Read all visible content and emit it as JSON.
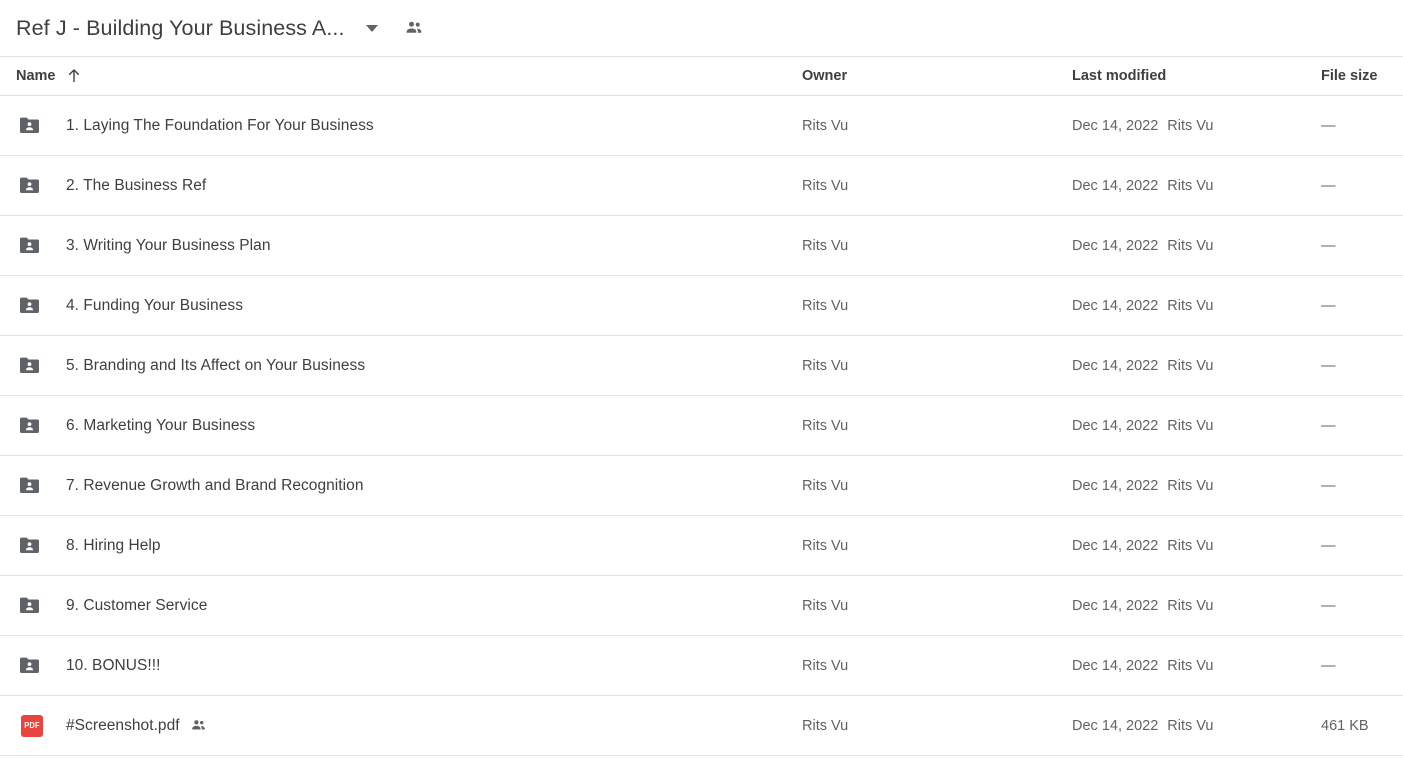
{
  "header": {
    "folder_title": "Ref J - Building Your Business A...",
    "caret_icon": "chevron-down-icon",
    "shared_icon": "people-shared-icon"
  },
  "table": {
    "columns": {
      "name": "Name",
      "owner": "Owner",
      "last_modified": "Last modified",
      "file_size": "File size"
    },
    "sort": {
      "column": "Name",
      "direction": "ascending",
      "icon": "arrow-up-icon"
    },
    "rows": [
      {
        "icon": "shared-folder-icon",
        "name": "1. Laying The Foundation For Your Business",
        "shared_badge": false,
        "owner": "Rits Vu",
        "modified_date": "Dec 14, 2022",
        "modified_by": "Rits Vu",
        "size": "—"
      },
      {
        "icon": "shared-folder-icon",
        "name": "2. The Business Ref",
        "shared_badge": false,
        "owner": "Rits Vu",
        "modified_date": "Dec 14, 2022",
        "modified_by": "Rits Vu",
        "size": "—"
      },
      {
        "icon": "shared-folder-icon",
        "name": "3. Writing Your Business Plan",
        "shared_badge": false,
        "owner": "Rits Vu",
        "modified_date": "Dec 14, 2022",
        "modified_by": "Rits Vu",
        "size": "—"
      },
      {
        "icon": "shared-folder-icon",
        "name": "4. Funding Your Business",
        "shared_badge": false,
        "owner": "Rits Vu",
        "modified_date": "Dec 14, 2022",
        "modified_by": "Rits Vu",
        "size": "—"
      },
      {
        "icon": "shared-folder-icon",
        "name": "5. Branding and Its Affect on Your Business",
        "shared_badge": false,
        "owner": "Rits Vu",
        "modified_date": "Dec 14, 2022",
        "modified_by": "Rits Vu",
        "size": "—"
      },
      {
        "icon": "shared-folder-icon",
        "name": "6. Marketing Your Business",
        "shared_badge": false,
        "owner": "Rits Vu",
        "modified_date": "Dec 14, 2022",
        "modified_by": "Rits Vu",
        "size": "—"
      },
      {
        "icon": "shared-folder-icon",
        "name": "7. Revenue Growth and Brand Recognition",
        "shared_badge": false,
        "owner": "Rits Vu",
        "modified_date": "Dec 14, 2022",
        "modified_by": "Rits Vu",
        "size": "—"
      },
      {
        "icon": "shared-folder-icon",
        "name": "8. Hiring Help",
        "shared_badge": false,
        "owner": "Rits Vu",
        "modified_date": "Dec 14, 2022",
        "modified_by": "Rits Vu",
        "size": "—"
      },
      {
        "icon": "shared-folder-icon",
        "name": "9. Customer Service",
        "shared_badge": false,
        "owner": "Rits Vu",
        "modified_date": "Dec 14, 2022",
        "modified_by": "Rits Vu",
        "size": "—"
      },
      {
        "icon": "shared-folder-icon",
        "name": "10. BONUS!!!",
        "shared_badge": false,
        "owner": "Rits Vu",
        "modified_date": "Dec 14, 2022",
        "modified_by": "Rits Vu",
        "size": "—"
      },
      {
        "icon": "pdf-file-icon",
        "icon_label": "PDF",
        "name": "#Screenshot.pdf",
        "shared_badge": true,
        "owner": "Rits Vu",
        "modified_date": "Dec 14, 2022",
        "modified_by": "Rits Vu",
        "size": "461 KB"
      }
    ]
  },
  "colors": {
    "text_primary": "#3c4043",
    "text_secondary": "#5f6368",
    "folder_icon": "#5f6368",
    "pdf_red": "#e8453c",
    "divider": "#e4e4e4",
    "background": "#ffffff"
  }
}
